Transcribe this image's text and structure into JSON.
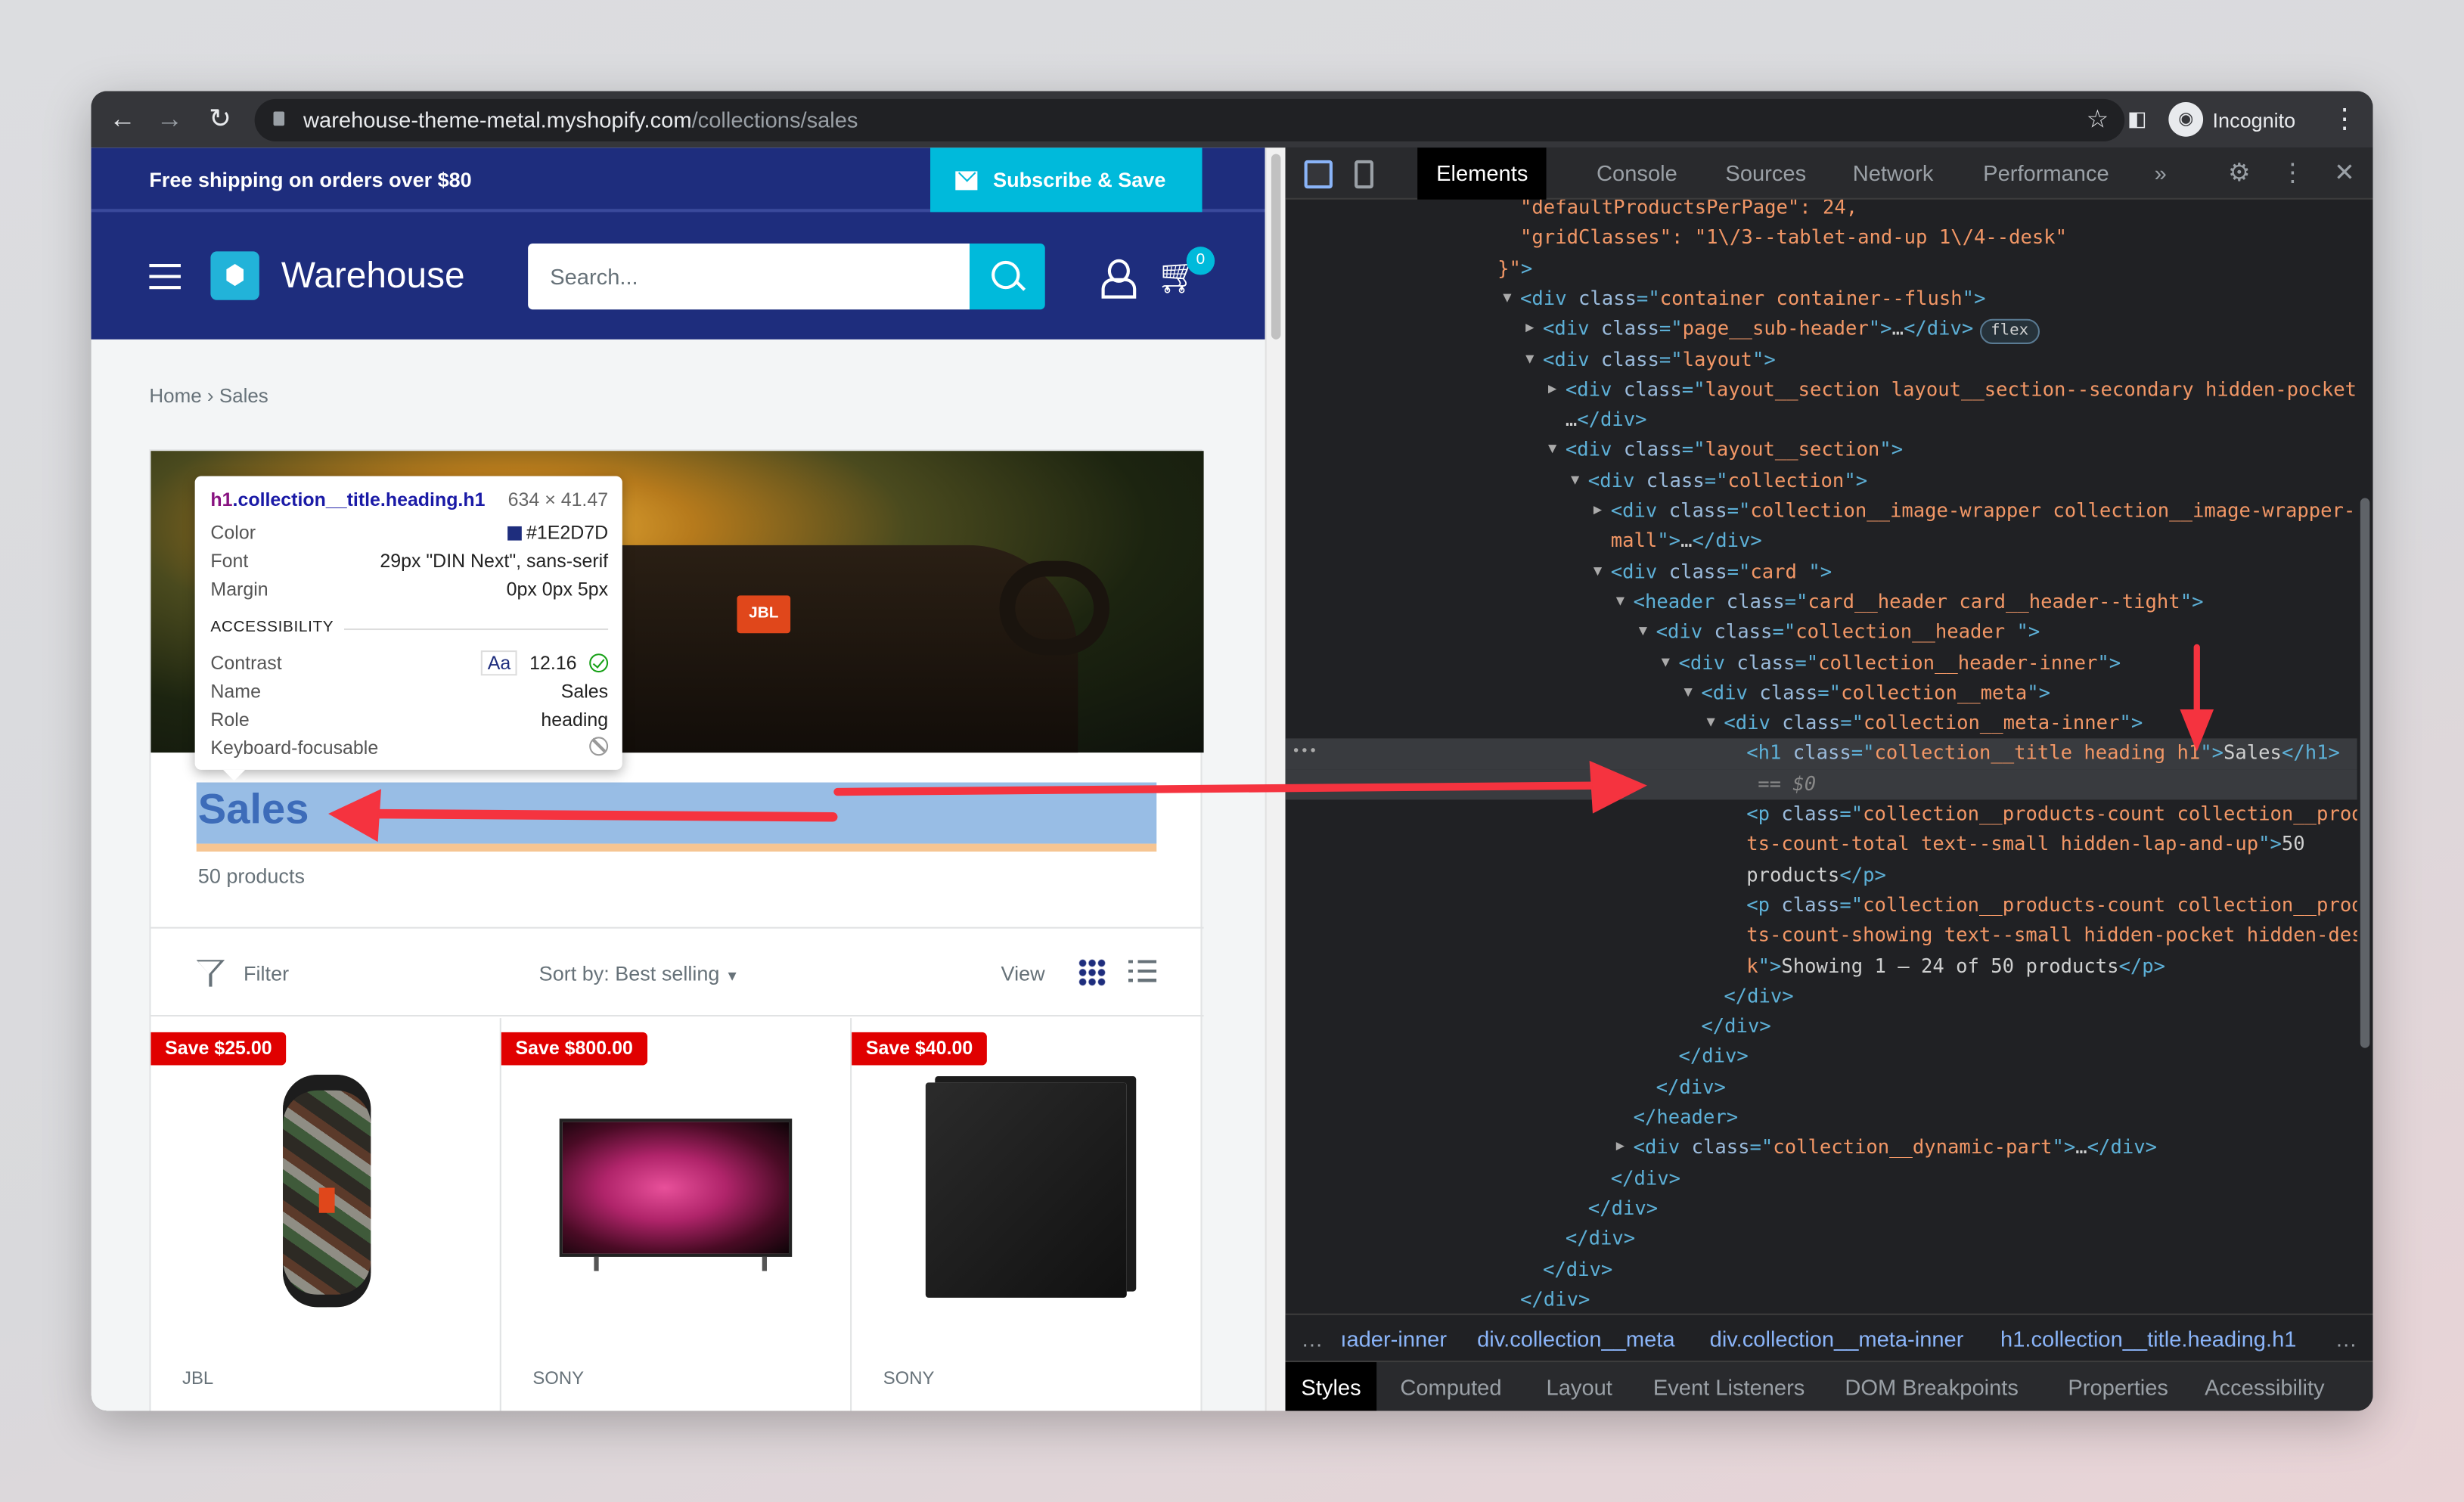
{
  "browser": {
    "url_host": "warehouse-theme-metal.myshopify.com",
    "url_path": "/collections/sales",
    "profile": "Incognito",
    "icons": {
      "back": "arrow-left",
      "forward": "arrow-right",
      "reload": "reload",
      "bookmark": "star",
      "sidepanel": "sidebar",
      "menu": "kebab"
    }
  },
  "store": {
    "announcement": "Free shipping on orders over $80",
    "subscribe": "Subscribe & Save",
    "logo": "Warehouse",
    "search_placeholder": "Search...",
    "cart_count": "0",
    "breadcrumb": [
      "Home",
      "Sales"
    ],
    "breadcrumb_sep": "›",
    "hero_logo": "JBL",
    "title": "Sales",
    "count": "50 products",
    "toolbar": {
      "filter": "Filter",
      "sort": "Sort by: Best selling",
      "view": "View"
    },
    "products": [
      {
        "badge": "Save $25.00",
        "brand": "JBL"
      },
      {
        "badge": "Save $800.00",
        "brand": "SONY"
      },
      {
        "badge": "Save $40.00",
        "brand": "SONY"
      }
    ],
    "colors": {
      "brand": "#1e2d7d",
      "accent": "#00badb",
      "sale": "#e00000"
    }
  },
  "tooltip": {
    "selector_tag": "h1",
    "selector_rest": ".collection__title.heading.h1",
    "size": "634 × 41.47",
    "rows": [
      [
        "Color",
        "#1E2D7D"
      ],
      [
        "Font",
        "29px \"DIN Next\", sans-serif"
      ],
      [
        "Margin",
        "0px 0px 5px"
      ]
    ],
    "accessibility": "ACCESSIBILITY",
    "contrast_label": "Contrast",
    "contrast_aa": "Aa",
    "contrast_value": "12.16",
    "name_label": "Name",
    "name_value": "Sales",
    "role_label": "Role",
    "role_value": "heading",
    "kbd_label": "Keyboard-focusable"
  },
  "devtools": {
    "tabs": [
      "Elements",
      "Console",
      "Sources",
      "Network",
      "Performance",
      "»"
    ],
    "active_tab": "Elements",
    "tree": [
      {
        "d": 1,
        "s": [
          [
            "av",
            "\"defaultProductsPerPage\": 24,"
          ]
        ]
      },
      {
        "d": 1,
        "s": [
          [
            "av",
            "\"gridClasses\": \"1\\/3--tablet-and-up 1\\/4--desk\""
          ]
        ]
      },
      {
        "d": 0,
        "s": [
          [
            "av",
            "}\""
          ],
          [
            "tg",
            ">"
          ]
        ]
      },
      {
        "d": 1,
        "a": "open",
        "s": [
          [
            "tg",
            "<div "
          ],
          [
            "an",
            "class"
          ],
          [
            "tg",
            "=\""
          ],
          [
            "av",
            "container container--flush"
          ],
          [
            "tg",
            "\">"
          ]
        ]
      },
      {
        "d": 2,
        "a": "closed",
        "s": [
          [
            "tg",
            "<div "
          ],
          [
            "an",
            "class"
          ],
          [
            "tg",
            "=\""
          ],
          [
            "av",
            "page__sub-header"
          ],
          [
            "tg",
            "\">"
          ],
          [
            "tx",
            "…"
          ],
          [
            "tg",
            "</div>"
          ]
        ],
        "badge": "flex"
      },
      {
        "d": 2,
        "a": "open",
        "s": [
          [
            "tg",
            "<div "
          ],
          [
            "an",
            "class"
          ],
          [
            "tg",
            "=\""
          ],
          [
            "av",
            "layout"
          ],
          [
            "tg",
            "\">"
          ]
        ]
      },
      {
        "d": 3,
        "a": "closed",
        "s": [
          [
            "tg",
            "<div "
          ],
          [
            "an",
            "class"
          ],
          [
            "tg",
            "=\""
          ],
          [
            "av",
            "layout__section layout__section--secondary hidden-pocket"
          ],
          [
            "tg",
            "\">"
          ]
        ]
      },
      {
        "d": 3,
        "s": [
          [
            "tx",
            "…"
          ],
          [
            "tg",
            "</div>"
          ]
        ]
      },
      {
        "d": 3,
        "a": "open",
        "s": [
          [
            "tg",
            "<div "
          ],
          [
            "an",
            "class"
          ],
          [
            "tg",
            "=\""
          ],
          [
            "av",
            "layout__section"
          ],
          [
            "tg",
            "\">"
          ]
        ]
      },
      {
        "d": 4,
        "a": "open",
        "s": [
          [
            "tg",
            "<div "
          ],
          [
            "an",
            "class"
          ],
          [
            "tg",
            "=\""
          ],
          [
            "av",
            "collection"
          ],
          [
            "tg",
            "\">"
          ]
        ]
      },
      {
        "d": 5,
        "a": "closed",
        "s": [
          [
            "tg",
            "<div "
          ],
          [
            "an",
            "class"
          ],
          [
            "tg",
            "=\""
          ],
          [
            "av",
            "collection__image-wrapper collection__image-wrapper--s"
          ]
        ]
      },
      {
        "d": 5,
        "s": [
          [
            "av",
            "mall"
          ],
          [
            "tg",
            "\">"
          ],
          [
            "tx",
            "…"
          ],
          [
            "tg",
            "</div>"
          ]
        ]
      },
      {
        "d": 5,
        "a": "open",
        "s": [
          [
            "tg",
            "<div "
          ],
          [
            "an",
            "class"
          ],
          [
            "tg",
            "=\""
          ],
          [
            "av",
            "card "
          ],
          [
            "tg",
            "\">"
          ]
        ]
      },
      {
        "d": 6,
        "a": "open",
        "s": [
          [
            "tg",
            "<header "
          ],
          [
            "an",
            "class"
          ],
          [
            "tg",
            "=\""
          ],
          [
            "av",
            "card__header card__header--tight"
          ],
          [
            "tg",
            "\">"
          ]
        ]
      },
      {
        "d": 7,
        "a": "open",
        "s": [
          [
            "tg",
            "<div "
          ],
          [
            "an",
            "class"
          ],
          [
            "tg",
            "=\""
          ],
          [
            "av",
            "collection__header "
          ],
          [
            "tg",
            "\">"
          ]
        ]
      },
      {
        "d": 8,
        "a": "open",
        "s": [
          [
            "tg",
            "<div "
          ],
          [
            "an",
            "class"
          ],
          [
            "tg",
            "=\""
          ],
          [
            "av",
            "collection__header-inner"
          ],
          [
            "tg",
            "\">"
          ]
        ]
      },
      {
        "d": 9,
        "a": "open",
        "s": [
          [
            "tg",
            "<div "
          ],
          [
            "an",
            "class"
          ],
          [
            "tg",
            "=\""
          ],
          [
            "av",
            "collection__meta"
          ],
          [
            "tg",
            "\">"
          ]
        ]
      },
      {
        "d": 10,
        "a": "open",
        "s": [
          [
            "tg",
            "<div "
          ],
          [
            "an",
            "class"
          ],
          [
            "tg",
            "=\""
          ],
          [
            "av",
            "collection__meta-inner"
          ],
          [
            "tg",
            "\">"
          ]
        ]
      },
      {
        "d": 11,
        "sel": true,
        "s": [
          [
            "tg",
            "<h1 "
          ],
          [
            "an",
            "class"
          ],
          [
            "tg",
            "=\""
          ],
          [
            "av",
            "collection__title heading h1"
          ],
          [
            "tg",
            "\">"
          ],
          [
            "tx",
            "Sales"
          ],
          [
            "tg",
            "</h1>"
          ]
        ]
      },
      {
        "d": 11.5,
        "sel": true,
        "s": [
          [
            "dl",
            "== $0"
          ]
        ]
      },
      {
        "d": 11,
        "s": [
          [
            "tg",
            "<p "
          ],
          [
            "an",
            "class"
          ],
          [
            "tg",
            "=\""
          ],
          [
            "av",
            "collection__products-count collection__produc"
          ]
        ]
      },
      {
        "d": 11,
        "s": [
          [
            "av",
            "ts-count-total text--small hidden-lap-and-up"
          ],
          [
            "tg",
            "\">"
          ],
          [
            "tx",
            "50"
          ]
        ]
      },
      {
        "d": 11,
        "s": [
          [
            "tx",
            "products"
          ],
          [
            "tg",
            "</p>"
          ]
        ]
      },
      {
        "d": 11,
        "s": [
          [
            "tg",
            "<p "
          ],
          [
            "an",
            "class"
          ],
          [
            "tg",
            "=\""
          ],
          [
            "av",
            "collection__products-count collection__produc"
          ]
        ]
      },
      {
        "d": 11,
        "s": [
          [
            "av",
            "ts-count-showing text--small hidden-pocket hidden-des"
          ]
        ]
      },
      {
        "d": 11,
        "s": [
          [
            "av",
            "k"
          ],
          [
            "tg",
            "\">"
          ],
          [
            "tx",
            "Showing 1 – 24 of 50 products"
          ],
          [
            "tg",
            "</p>"
          ]
        ]
      },
      {
        "d": 10,
        "s": [
          [
            "tg",
            "</div>"
          ]
        ]
      },
      {
        "d": 9,
        "s": [
          [
            "tg",
            "</div>"
          ]
        ]
      },
      {
        "d": 8,
        "s": [
          [
            "tg",
            "</div>"
          ]
        ]
      },
      {
        "d": 7,
        "s": [
          [
            "tg",
            "</div>"
          ]
        ]
      },
      {
        "d": 6,
        "s": [
          [
            "tg",
            "</header>"
          ]
        ]
      },
      {
        "d": 6,
        "a": "closed",
        "s": [
          [
            "tg",
            "<div "
          ],
          [
            "an",
            "class"
          ],
          [
            "tg",
            "=\""
          ],
          [
            "av",
            "collection__dynamic-part"
          ],
          [
            "tg",
            "\">"
          ],
          [
            "tx",
            "…"
          ],
          [
            "tg",
            "</div>"
          ]
        ]
      },
      {
        "d": 5,
        "s": [
          [
            "tg",
            "</div>"
          ]
        ]
      },
      {
        "d": 4,
        "s": [
          [
            "tg",
            "</div>"
          ]
        ]
      },
      {
        "d": 3,
        "s": [
          [
            "tg",
            "</div>"
          ]
        ]
      },
      {
        "d": 2,
        "s": [
          [
            "tg",
            "</div>"
          ]
        ]
      },
      {
        "d": 1,
        "s": [
          [
            "tg",
            "</div>"
          ]
        ]
      }
    ],
    "breadcrumbs": [
      "…",
      "ıader-inner",
      "div.collection__meta",
      "div.collection__meta-inner",
      "h1.collection__title.heading.h1",
      "…"
    ],
    "bottom_tabs": [
      "Styles",
      "Computed",
      "Layout",
      "Event Listeners",
      "DOM Breakpoints",
      "Properties",
      "Accessibility"
    ],
    "active_bottom_tab": "Styles",
    "colors": {
      "tag": "#5db0d7",
      "attr": "#9bbbdc",
      "value": "#f29766",
      "annotation_arrow": "#f5333f"
    }
  }
}
